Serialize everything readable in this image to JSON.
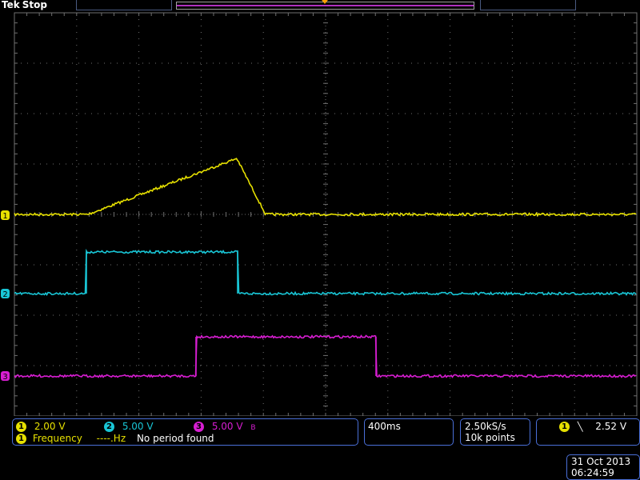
{
  "header": {
    "brand": "Tek",
    "status": "Stop"
  },
  "channels": [
    {
      "id": "1",
      "color": "#e6e000",
      "scale": "2.00 V"
    },
    {
      "id": "2",
      "color": "#19c6d6",
      "scale": "5.00 V"
    },
    {
      "id": "3",
      "color": "#d81ed2",
      "scale": "5.00 V"
    }
  ],
  "ch3_bw_symbol": "B",
  "measurement": {
    "channel": "1",
    "label": "Frequency",
    "value": "----.Hz",
    "status": "No period found"
  },
  "horizontal": {
    "timebase": "400ms"
  },
  "acquisition": {
    "sample_rate": "2.50kS/s",
    "record_length": "10k points"
  },
  "trigger": {
    "channel": "1",
    "slope_symbol": "╲",
    "level": "2.52 V"
  },
  "datetime": {
    "date": "31 Oct  2013",
    "time": "06:24:59"
  },
  "colors": {
    "grid": "#707070",
    "panel_border": "#4a6fd8",
    "ch1": "#e6e000",
    "ch2": "#19c6d6",
    "ch3": "#d81ed2",
    "trigger_marker": "#ffa000"
  }
}
